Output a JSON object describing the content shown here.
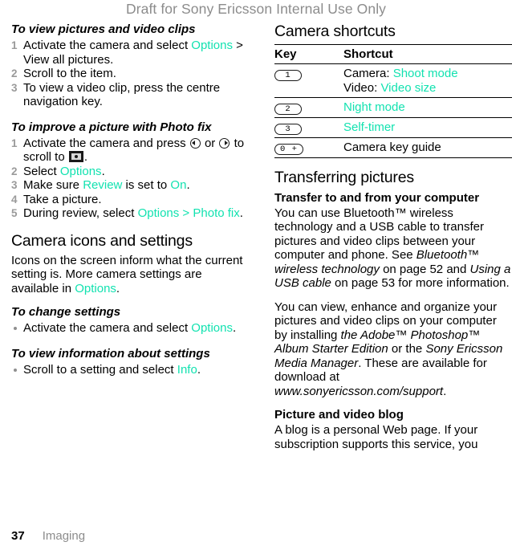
{
  "watermark": "Draft for Sony Ericsson Internal Use Only",
  "left_column": {
    "proc_view": {
      "heading": "To view pictures and video clips",
      "steps": [
        {
          "pre": "Activate the camera and select ",
          "link": "Options",
          "post": " > View all pictures."
        },
        {
          "pre": "Scroll to the item.",
          "link": "",
          "post": ""
        },
        {
          "pre": "To view a video clip, press the centre navigation key.",
          "link": "",
          "post": ""
        }
      ]
    },
    "proc_photofix": {
      "heading": "To improve a picture with Photo fix",
      "step1_a": "Activate the camera and press ",
      "step1_b": " or ",
      "step1_c": " to scroll to ",
      "step1_d": ".",
      "step2_pre": "Select ",
      "step2_link": "Options",
      "step2_post": ".",
      "step3_pre": "Make sure ",
      "step3_link1": "Review",
      "step3_mid": " is set to ",
      "step3_link2": "On",
      "step3_post": ".",
      "step4": "Take a picture.",
      "step5_pre": "During review, select ",
      "step5_link1": "Options",
      "step5_mid": " > ",
      "step5_link2": "Photo fix",
      "step5_post": "."
    },
    "section_icons": {
      "heading": "Camera icons and settings",
      "body_pre": "Icons on the screen inform what the current setting is. More camera settings are available in ",
      "body_link": "Options",
      "body_post": "."
    },
    "proc_change": {
      "heading": "To change settings",
      "bullet_pre": "Activate the camera and select ",
      "bullet_link": "Options",
      "bullet_post": "."
    },
    "proc_info": {
      "heading": "To view information about settings",
      "bullet_pre": "Scroll to a setting and select ",
      "bullet_link": "Info",
      "bullet_post": "."
    }
  },
  "right_column": {
    "section_shortcuts": {
      "heading": "Camera shortcuts",
      "table": {
        "columns": [
          "Key",
          "Shortcut"
        ],
        "rows": [
          {
            "key": "1",
            "lines": [
              {
                "label": "Camera: ",
                "link": "Shoot mode"
              },
              {
                "label": "Video: ",
                "link": "Video size"
              }
            ]
          },
          {
            "key": "2",
            "lines": [
              {
                "label": "",
                "link": "Night mode"
              }
            ]
          },
          {
            "key": "3",
            "lines": [
              {
                "label": "",
                "link": "Self-timer"
              }
            ]
          },
          {
            "key": "0 +",
            "lines": [
              {
                "label": "Camera key guide",
                "link": ""
              }
            ]
          }
        ]
      }
    },
    "section_transfer": {
      "heading": "Transferring pictures",
      "sub1": "Transfer to and from your computer",
      "p1_a": "You can use Bluetooth™ wireless technology and a USB cable to transfer pictures and video clips between your computer and phone. See ",
      "p1_i1": "Bluetooth™ wireless technology",
      "p1_b": " on page 52 and ",
      "p1_i2": "Using a USB cable",
      "p1_c": " on page 53 for more information.",
      "p2_a": "You can view, enhance and organize your pictures and video clips on your computer by installing ",
      "p2_i1": "the Adobe™ Photoshop™ Album Starter Edition",
      "p2_b": " or the ",
      "p2_i2": "Sony Ericsson Media Manager",
      "p2_c": ". These are available for download at ",
      "p2_i3": "www.sonyericsson.com/support",
      "p2_d": ".",
      "sub2": "Picture and video blog",
      "p3": "A blog is a personal Web page. If your subscription supports this service, you"
    }
  },
  "footer": {
    "page_number": "37",
    "chapter": "Imaging"
  }
}
